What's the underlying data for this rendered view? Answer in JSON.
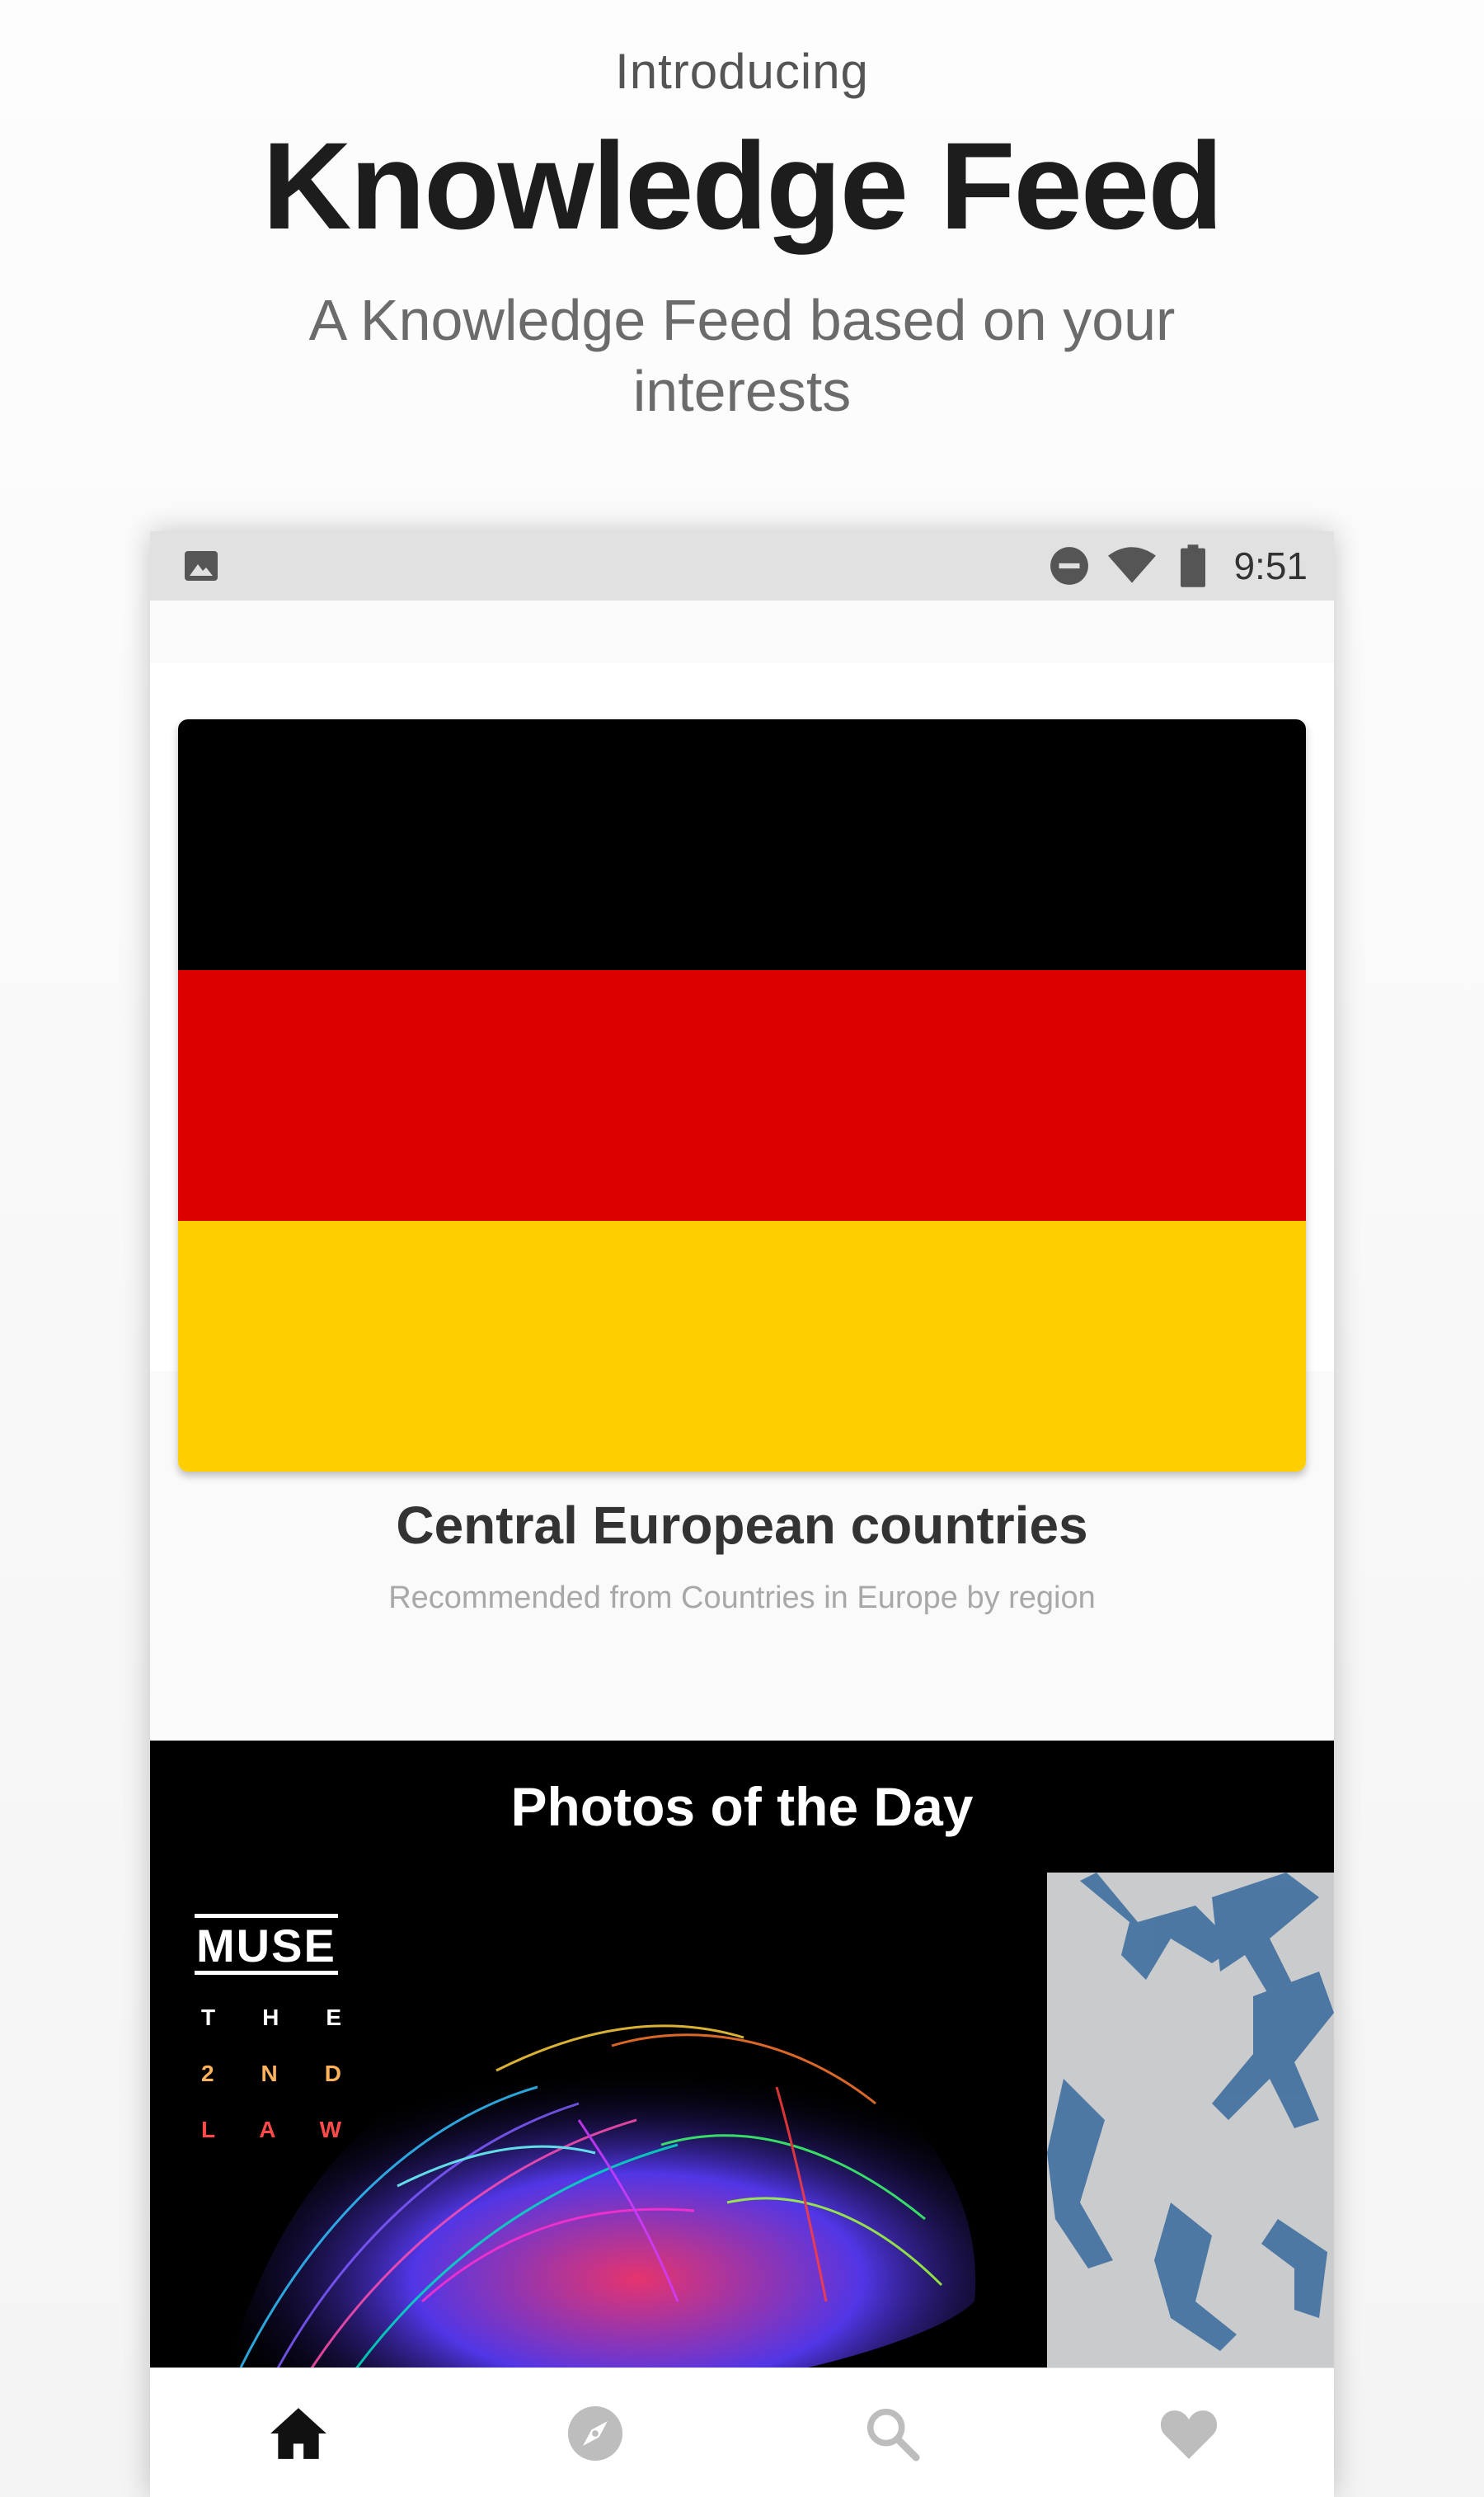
{
  "promo": {
    "intro": "Introducing",
    "headline": "Knowledge Feed",
    "subtitle": "A Knowledge Feed based on your interests"
  },
  "status_bar": {
    "time": "9:51",
    "icons": [
      "image-notification-icon",
      "do-not-disturb-icon",
      "wifi-icon",
      "battery-icon"
    ]
  },
  "feed_card": {
    "title": "Central European countries",
    "subtitle": "Recommended from Countries in Europe by region",
    "image": {
      "icon": "flag-of-germany-image",
      "stripe_colors": [
        "#000000",
        "#dd0000",
        "#ffce00"
      ]
    }
  },
  "photos_of_the_day": {
    "title": "Photos of the Day",
    "album_art": {
      "logo": "MUSE",
      "words_rows": [
        [
          "T",
          "H",
          "E"
        ],
        [
          "2",
          "N",
          "D"
        ],
        [
          "L",
          "A",
          "W"
        ]
      ]
    }
  },
  "bottom_nav": {
    "items": [
      {
        "icon": "home-icon",
        "active": true
      },
      {
        "icon": "explore-compass-icon",
        "active": false
      },
      {
        "icon": "search-icon",
        "active": false
      },
      {
        "icon": "favorites-heart-icon",
        "active": false
      }
    ]
  },
  "colors": {
    "status_bar_bg": "#e1e1e1",
    "nav_active": "#111111",
    "nav_inactive": "#bdbdbd",
    "photos_bg": "#000000"
  }
}
